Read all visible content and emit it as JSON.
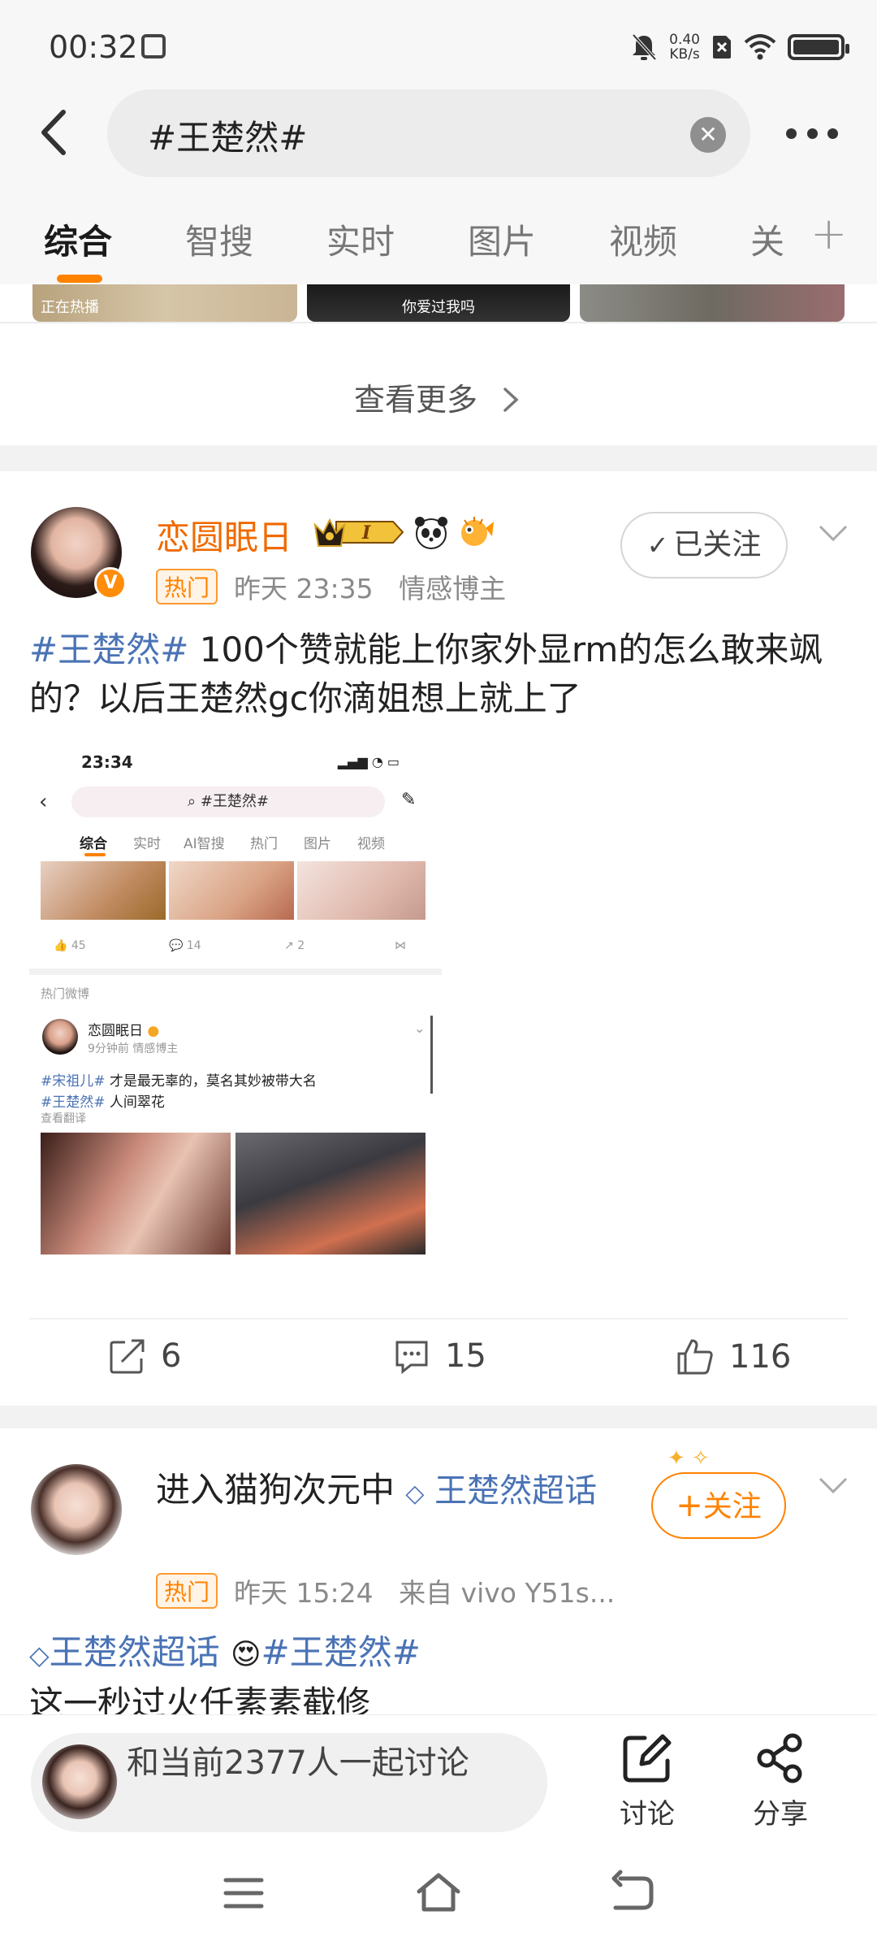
{
  "status_bar": {
    "time": "00:32",
    "net_speed_value": "0.40",
    "net_speed_unit": "KB/s"
  },
  "search": {
    "query": "#王楚然#",
    "clear_icon": "clear-icon"
  },
  "tabs": [
    {
      "label": "综合",
      "active": true
    },
    {
      "label": "智搜",
      "active": false
    },
    {
      "label": "实时",
      "active": false
    },
    {
      "label": "图片",
      "active": false
    },
    {
      "label": "视频",
      "active": false
    },
    {
      "label": "关",
      "active": false
    }
  ],
  "thumb_strip": {
    "thumb2_text": "你爱过我吗",
    "thumb1_text": "正在热播"
  },
  "see_more": {
    "label": "查看更多"
  },
  "post1": {
    "username": "恋圆眠日",
    "badge": "热门",
    "time": "昨天 23:35",
    "tag": "情感博主",
    "follow_label": "已关注",
    "text_topic": "#王楚然#",
    "text_body": " 100个赞就能上你家外显rm的怎么敢来飒的？以后王楚然gc你滴姐想上就上了",
    "embed": {
      "time": "23:34",
      "search": "#王楚然#",
      "tabs": [
        "综合",
        "实时",
        "AI智搜",
        "热门",
        "图片",
        "视频"
      ],
      "stats": [
        "45",
        "14",
        "2"
      ],
      "section_label": "热门微博",
      "inner_user": "恋圆眠日",
      "inner_meta": "9分钟前  情感博主",
      "inner_line1_topic": "#宋祖儿#",
      "inner_line1_text": " 才是最无辜的，莫名其妙被带大名",
      "inner_line2_topic": "#王楚然#",
      "inner_line2_text": " 人间翠花",
      "inner_translate": "查看翻译"
    },
    "shares": "6",
    "comments": "15",
    "likes": "116"
  },
  "post2": {
    "username": "进入猫狗次元中",
    "supertopic": "王楚然超话",
    "badge": "热门",
    "time": "昨天 15:24",
    "source": "来自 vivo Y51s...",
    "follow_label": "关注",
    "text_supertopic": "王楚然超话",
    "text_topic": "#王楚然#",
    "text_line2": "这一秒过火任素素截修"
  },
  "bottom_bar": {
    "discuss_prompt": "和当前2377人一起讨论",
    "discuss_label": "讨论",
    "share_label": "分享"
  },
  "colors": {
    "accent": "#ff8200",
    "topic": "#4a73b5",
    "verify": "#ff8d0a"
  }
}
